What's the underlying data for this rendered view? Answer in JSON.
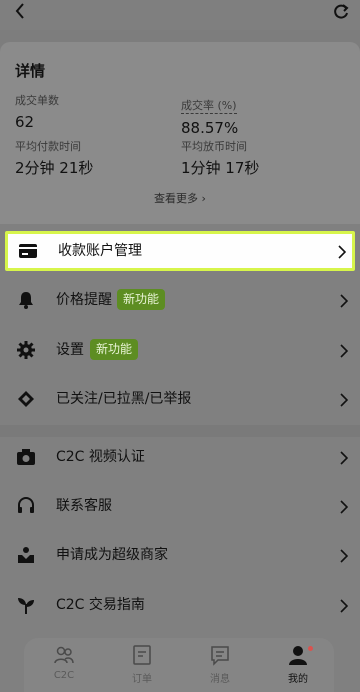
{
  "details": {
    "title": "详情",
    "stats": [
      {
        "label": "成交单数",
        "value": "62"
      },
      {
        "label": "成交率 (%)",
        "value": "88.57%"
      },
      {
        "label": "平均付款时间",
        "value": "2分钟 21秒"
      },
      {
        "label": "平均放币时间",
        "value": "1分钟 17秒"
      }
    ],
    "see_more": "查看更多 ›"
  },
  "menu": {
    "items": [
      {
        "label": "收款账户管理",
        "icon": "card-icon"
      },
      {
        "label": "价格提醒",
        "icon": "bell-icon",
        "badge": "新功能"
      },
      {
        "label": "设置",
        "icon": "gear-icon",
        "badge": "新功能"
      },
      {
        "label": "已关注/已拉黑/已举报",
        "icon": "tag-icon"
      },
      {
        "label": "C2C 视频认证",
        "icon": "camera-icon"
      },
      {
        "label": "联系客服",
        "icon": "headset-icon"
      },
      {
        "label": "申请成为超级商家",
        "icon": "merchant-icon"
      },
      {
        "label": "C2C 交易指南",
        "icon": "sprout-icon"
      }
    ]
  },
  "tabs": [
    {
      "label": "C2C",
      "icon": "people-icon"
    },
    {
      "label": "订单",
      "icon": "order-icon"
    },
    {
      "label": "消息",
      "icon": "message-icon"
    },
    {
      "label": "我的",
      "icon": "profile-icon",
      "active": true
    }
  ],
  "colors": {
    "highlight_border": "#d7f54b",
    "badge_bg": "#5d8d22",
    "overlay": "#808080"
  }
}
